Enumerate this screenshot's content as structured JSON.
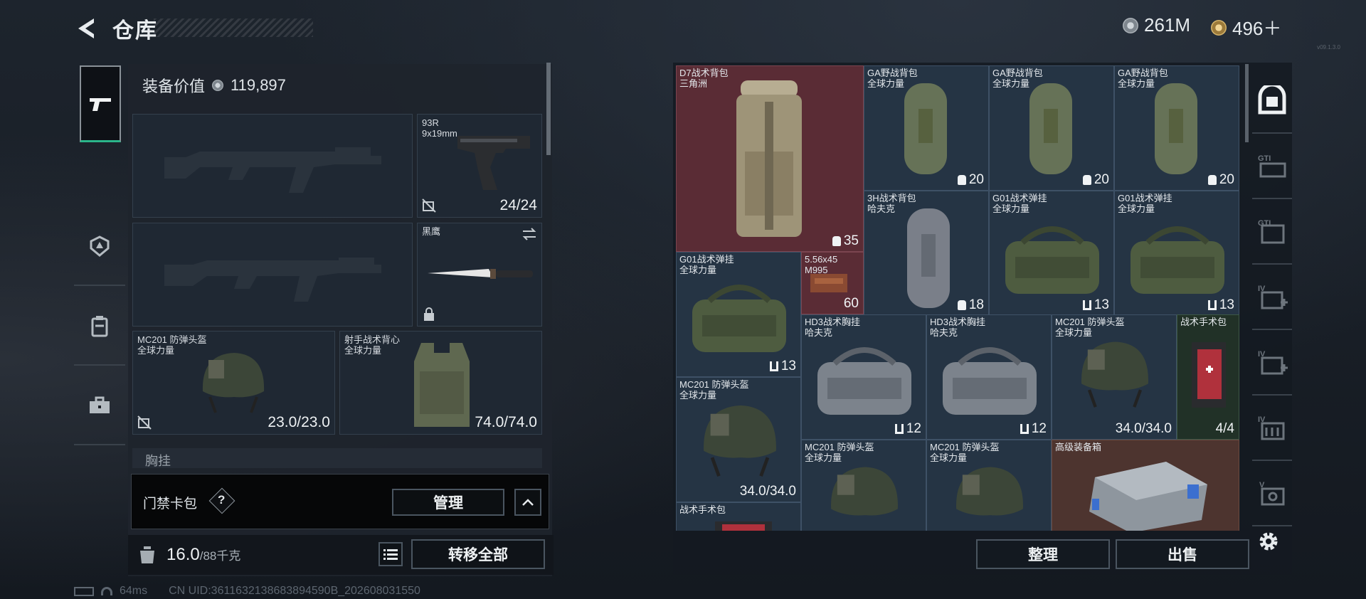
{
  "header": {
    "title": "仓库",
    "currency1": {
      "icon": "silver-coin-icon",
      "value": "261M"
    },
    "currency2": {
      "icon": "gold-coin-icon",
      "value": "496＋"
    }
  },
  "left_tabs": [
    {
      "icon": "pistol-icon",
      "active": true
    },
    {
      "icon": "armor-badge-icon",
      "active": false
    },
    {
      "icon": "vest-icon",
      "active": false
    },
    {
      "icon": "briefcase-icon",
      "active": false
    }
  ],
  "loadout": {
    "value_label": "装备价值",
    "value": "119,897",
    "slots": {
      "pistol": {
        "name": "93R",
        "sub": "9x19mm",
        "value": "24/24"
      },
      "melee": {
        "name": "黑鹰"
      },
      "helmet": {
        "name": "MC201 防弹头盔",
        "sub": "全球力量",
        "value": "23.0/23.0"
      },
      "armor": {
        "name": "射手战术背心",
        "sub": "全球力量",
        "value": "74.0/74.0"
      }
    },
    "chest_header": "胸挂",
    "keycard": {
      "label": "门禁卡包",
      "help": "?",
      "manage": "管理"
    },
    "weight": {
      "current": "16.0",
      "max": "/88千克"
    },
    "transfer_all": "转移全部"
  },
  "inventory": {
    "items": [
      {
        "name": "D7战术背包",
        "sub": "三角洲",
        "value": "35",
        "icon": "backpack-capacity-icon",
        "bg": "red"
      },
      {
        "name": "GA野战背包",
        "sub": "全球力量",
        "value": "20",
        "icon": "backpack-capacity-icon"
      },
      {
        "name": "GA野战背包",
        "sub": "全球力量",
        "value": "20",
        "icon": "backpack-capacity-icon"
      },
      {
        "name": "GA野战背包",
        "sub": "全球力量",
        "value": "20",
        "icon": "backpack-capacity-icon"
      },
      {
        "name": "3H战术背包",
        "sub": "哈夫克",
        "value": "18",
        "icon": "backpack-capacity-icon"
      },
      {
        "name": "G01战术弹挂",
        "sub": "全球力量",
        "value": "13",
        "icon": "rig-capacity-icon"
      },
      {
        "name": "G01战术弹挂",
        "sub": "全球力量",
        "value": "13",
        "icon": "rig-capacity-icon"
      },
      {
        "name": "G01战术弹挂",
        "sub": "全球力量",
        "value": "13",
        "icon": "rig-capacity-icon"
      },
      {
        "name": "5.56x45",
        "sub": "M995",
        "value": "60",
        "bg": "red"
      },
      {
        "name": "HD3战术胸挂",
        "sub": "哈夫克",
        "value": "12",
        "icon": "rig-capacity-icon"
      },
      {
        "name": "HD3战术胸挂",
        "sub": "哈夫克",
        "value": "12",
        "icon": "rig-capacity-icon"
      },
      {
        "name": "MC201 防弹头盔",
        "sub": "全球力量",
        "value": "34.0/34.0"
      },
      {
        "name": "战术手术包",
        "sub": "",
        "value": "4/4",
        "bg": "green"
      },
      {
        "name": "MC201 防弹头盔",
        "sub": "全球力量",
        "value": "34.0/34.0"
      },
      {
        "name": "MC201 防弹头盔",
        "sub": "全球力量",
        "value": ""
      },
      {
        "name": "MC201 防弹头盔",
        "sub": "全球力量",
        "value": ""
      },
      {
        "name": "高级装备箱",
        "sub": "",
        "value": "",
        "bg": "brown"
      },
      {
        "name": "战术手术包",
        "sub": "",
        "value": ""
      }
    ],
    "sort_button": "整理",
    "sell_button": "出售"
  },
  "right_tabs": [
    {
      "icon": "safe-box-icon",
      "active": true
    },
    {
      "icon": "storage-gti-icon",
      "label": "GTI"
    },
    {
      "icon": "storage-gti-2-icon",
      "label": "GTI"
    },
    {
      "icon": "medical-storage-iv-icon",
      "label": "IV"
    },
    {
      "icon": "medical-storage-iv-2-icon",
      "label": "IV"
    },
    {
      "icon": "storage-iv-3-icon",
      "label": "IV"
    },
    {
      "icon": "storage-v-icon",
      "label": "V"
    }
  ],
  "settings_icon": "gear-icon",
  "status": {
    "ping": "64ms",
    "uid": "CN UID:3611632138683894590B_202608031550"
  },
  "version": "v09.1.3.0"
}
